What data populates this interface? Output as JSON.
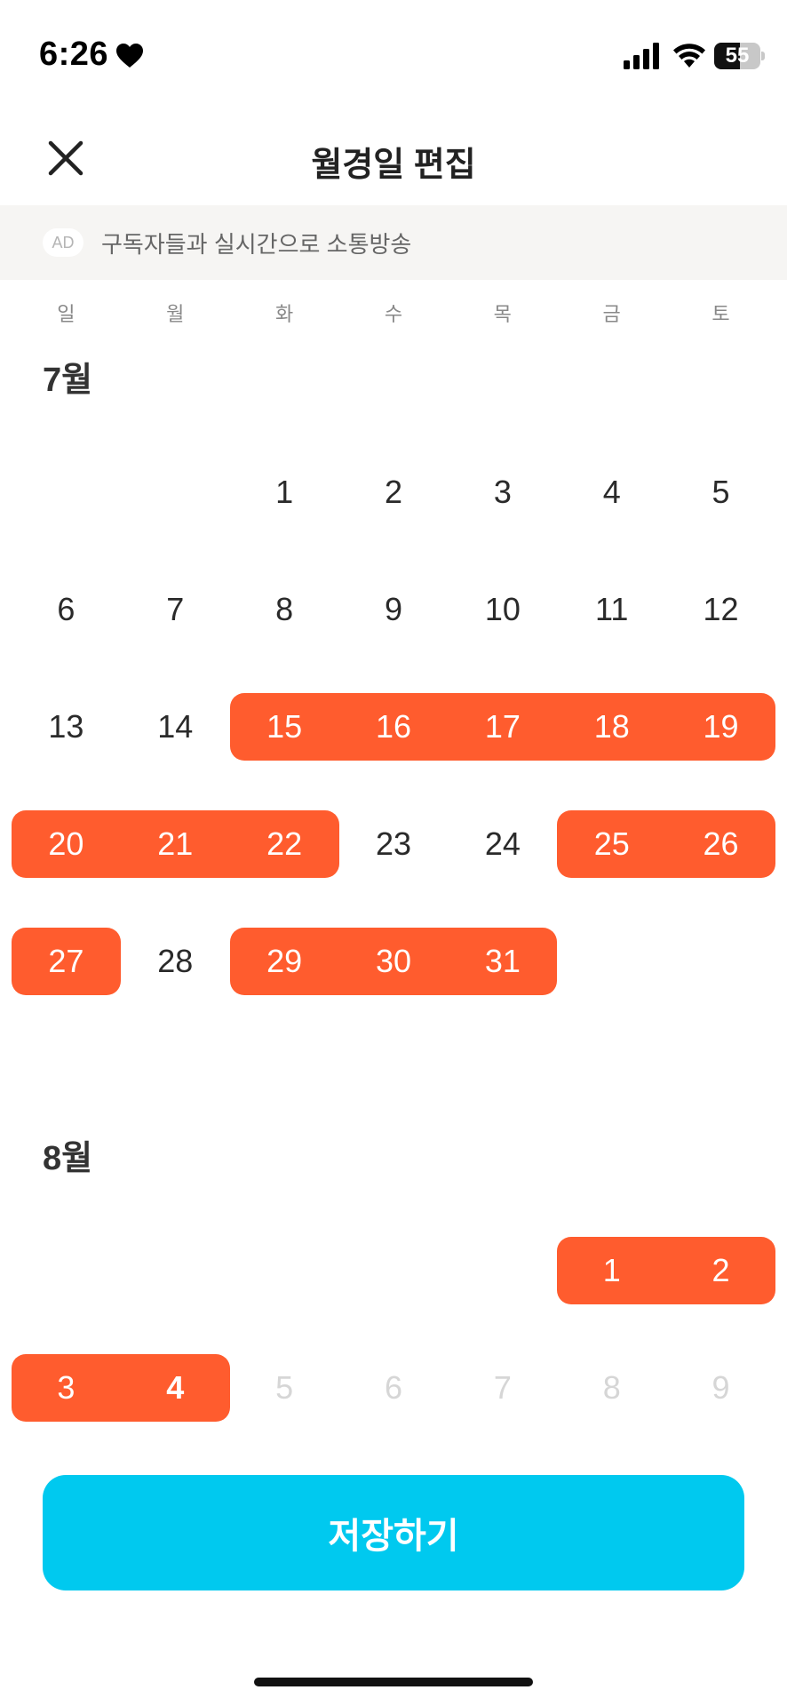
{
  "status_bar": {
    "time": "6:26",
    "battery_level": "55",
    "battery_fraction": 0.55,
    "icons": [
      "heart-icon",
      "signal-icon",
      "wifi-icon",
      "battery-icon"
    ]
  },
  "header": {
    "title": "월경일 편집",
    "close_icon": "close-icon"
  },
  "ad": {
    "badge": "AD",
    "text": "구독자들과 실시간으로 소통방송"
  },
  "weekdays": [
    "일",
    "월",
    "화",
    "수",
    "목",
    "금",
    "토"
  ],
  "months": [
    {
      "title": "7월",
      "leading_blanks": 2,
      "days": 31,
      "selected": [
        15,
        16,
        17,
        18,
        19,
        20,
        21,
        22,
        25,
        26,
        27,
        29,
        30,
        31
      ],
      "disabled": [],
      "today": null
    },
    {
      "title": "8월",
      "leading_blanks": 5,
      "days": 9,
      "selected": [
        1,
        2,
        3,
        4
      ],
      "disabled": [
        5,
        6,
        7,
        8,
        9
      ],
      "today": 4
    }
  ],
  "colors": {
    "selected": "#ff5c2e",
    "save_button": "#00c9ef",
    "disabled_text": "#d6d6d6"
  },
  "save_button": {
    "label": "저장하기"
  }
}
